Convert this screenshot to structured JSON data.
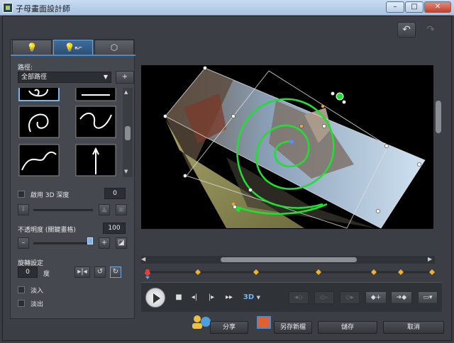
{
  "window": {
    "title": "子母畫面設計師",
    "minimize": "–",
    "maximize": "□",
    "close": "✕"
  },
  "history": {
    "undo_icon": "undo-arrow",
    "redo_icon": "redo-arrow"
  },
  "tabs": [
    {
      "icon": "bulb-icon"
    },
    {
      "icon": "bulb-path-icon",
      "active": true
    },
    {
      "icon": "mask-shape-icon"
    }
  ],
  "path": {
    "label": "路徑:",
    "selected": "全部路徑",
    "add_icon": "+"
  },
  "depth3d": {
    "label": "啟用 3D 深度",
    "value": "0"
  },
  "opacity": {
    "label": "不透明度 (關鍵畫格)",
    "value": "100",
    "minus": "–",
    "plus": "+"
  },
  "rotation": {
    "label": "旋轉設定",
    "value": "0",
    "unit": "度"
  },
  "fade": {
    "fade_in": "淡入",
    "fade_out": "淡出"
  },
  "playback": {
    "mode_3d": "3D"
  },
  "bottom": {
    "share": "分享",
    "save_as": "另存新檔",
    "save": "儲存",
    "cancel": "取消"
  },
  "colors": {
    "accent": "#4f8ac4",
    "path_green": "#22dd33",
    "keyframe": "#f0b030"
  }
}
